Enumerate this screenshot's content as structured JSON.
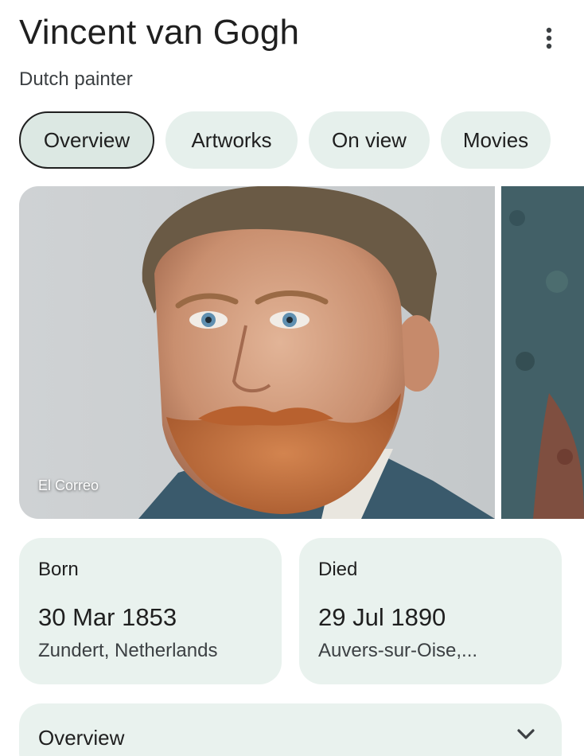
{
  "header": {
    "title": "Vincent van Gogh",
    "subtitle": "Dutch painter",
    "more_icon": "more-vert-icon"
  },
  "tabs": [
    {
      "label": "Overview",
      "active": true
    },
    {
      "label": "Artworks",
      "active": false
    },
    {
      "label": "On view",
      "active": false
    },
    {
      "label": "Movies",
      "active": false
    }
  ],
  "images": {
    "main_credit": "El Correo"
  },
  "facts": {
    "born": {
      "label": "Born",
      "date": "30 Mar 1853",
      "place": "Zundert, Netherlands"
    },
    "died": {
      "label": "Died",
      "date": "29 Jul 1890",
      "place": "Auvers-sur-Oise,..."
    }
  },
  "overview_section": {
    "label": "Overview",
    "icon": "chevron-down-icon"
  },
  "colors": {
    "chip_bg": "#e6f0ec",
    "card_bg": "#e9f2ee",
    "text": "#1f1f1f"
  }
}
